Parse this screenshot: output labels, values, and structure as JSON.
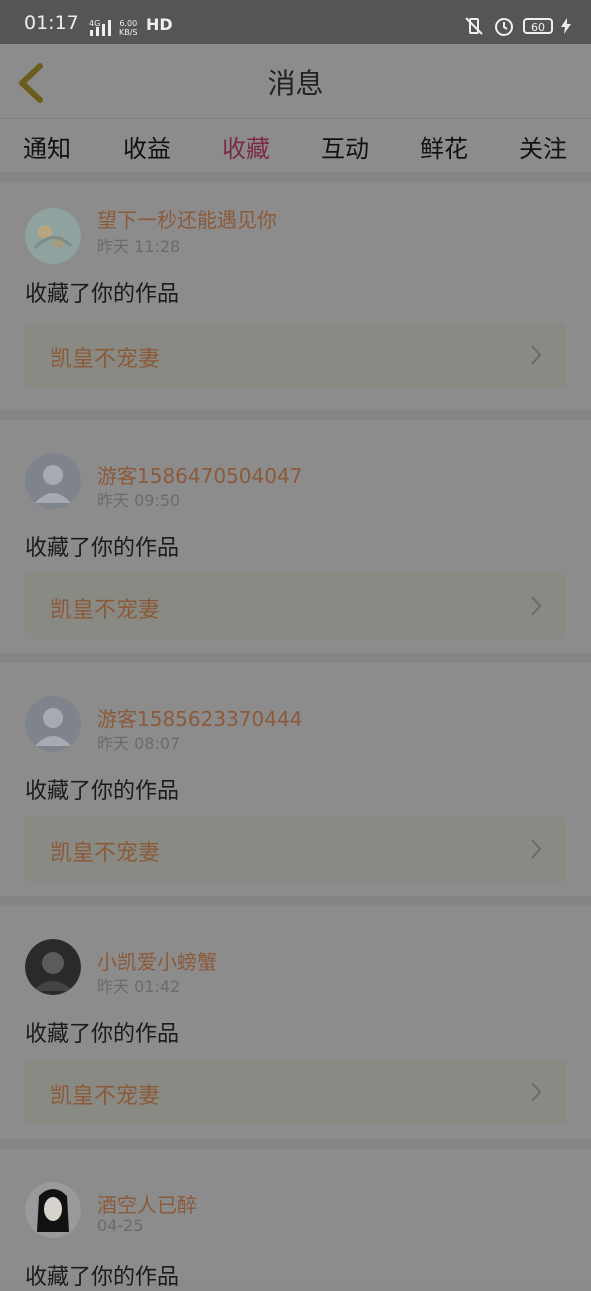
{
  "status": {
    "time": "01:17",
    "network": "4G",
    "speed_top": "6.00",
    "speed_bottom": "KB/S",
    "hd": "HD",
    "battery": "60"
  },
  "header": {
    "title": "消息"
  },
  "tabs": [
    {
      "label": "通知",
      "active": false
    },
    {
      "label": "收益",
      "active": false
    },
    {
      "label": "收藏",
      "active": true
    },
    {
      "label": "互动",
      "active": false
    },
    {
      "label": "鲜花",
      "active": false
    },
    {
      "label": "关注",
      "active": false
    }
  ],
  "messages": [
    {
      "user": "望下一秒还能遇见你",
      "time": "昨天 11:28",
      "action": "收藏了你的作品",
      "work": "凯皇不宠妻",
      "avatar": "flower-avatar-icon"
    },
    {
      "user": "游客1586470504047",
      "time": "昨天 09:50",
      "action": "收藏了你的作品",
      "work": "凯皇不宠妻",
      "avatar": "default-user-icon"
    },
    {
      "user": "游客1585623370444",
      "time": "昨天 08:07",
      "action": "收藏了你的作品",
      "work": "凯皇不宠妻",
      "avatar": "default-user-icon"
    },
    {
      "user": "小凯爱小螃蟹",
      "time": "昨天 01:42",
      "action": "收藏了你的作品",
      "work": "凯皇不宠妻",
      "avatar": "photo-avatar-icon"
    },
    {
      "user": "酒空人已醉",
      "time": "04-25",
      "action": "收藏了你的作品",
      "work": "",
      "avatar": "photo-avatar-icon"
    }
  ]
}
